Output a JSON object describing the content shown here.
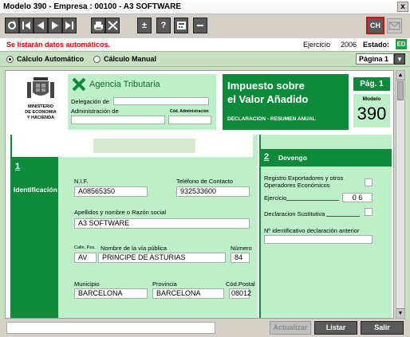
{
  "window": {
    "title": "Modelo 390 - Empresa : 00100 - A3 SOFTWARE",
    "close": "x"
  },
  "toolbar": {
    "ch_label": "CH",
    "plusminus": "±",
    "help": "?"
  },
  "info": {
    "warning": "Se listarán datos automáticos.",
    "ejercicio_label": "Ejercicio",
    "ejercicio_value": "2006",
    "estado_label": "Estado:",
    "estado_value": "ED"
  },
  "mode": {
    "auto_label": "Cálculo Automático",
    "manual_label": "Cálculo Manual",
    "selected": "auto",
    "page_value": "Página 1"
  },
  "header": {
    "ministry_line1": "MINISTERIO",
    "ministry_line2": "DE ECONOMIA",
    "ministry_line3": "Y HACIENDA",
    "agency": "Agencia Tributaria",
    "delegacion_label": "Delegación de",
    "administracion_label": "Administración de",
    "cod_admin_label": "Cód. Administración",
    "title_line1": "Impuesto sobre",
    "title_line2": "el Valor Añadido",
    "subtitle": "DECLARACION - RESUMEN ANUAL",
    "page_label": "Pág. 1",
    "modelo_label": "Modelo",
    "modelo_number": "390"
  },
  "identificacion": {
    "section_number": "1",
    "section_label": "Identificación",
    "nif_label": "N.I.F.",
    "nif_value": "A08565350",
    "telefono_label": "Teléfono de Contacto",
    "telefono_value": "932533600",
    "nombre_label": "Apellidos y nombre o Razón social",
    "nombre_value": "A3 SOFTWARE",
    "calle_prefix": "Calle, Pza.",
    "calle_label": "Nombre de la vía pública",
    "via_tipo": "AV",
    "via_nombre": "PRINCIPE DE ASTURIAS",
    "numero_label": "Número",
    "numero_value": "84",
    "municipio_label": "Municipio",
    "municipio_value": "BARCELONA",
    "provincia_label": "Provincia",
    "provincia_value": "BARCELONA",
    "cp_label": "Cód.Postal",
    "cp_value": "08012"
  },
  "devengo": {
    "section_number": "2",
    "section_label": "Devengo",
    "registro_label_1": "Registro Exportadores y otros",
    "registro_label_2": "Operadores Económicos",
    "ejercicio_label": "Ejercicio",
    "ejercicio_value": "0 6",
    "sustitutiva_label": "Declaracion Sustitutiva",
    "anterior_label": "Nº identificativo declaración anterior"
  },
  "bottom": {
    "actualizar": "Actualizar",
    "listar": "Listar",
    "salir": "Salir"
  }
}
